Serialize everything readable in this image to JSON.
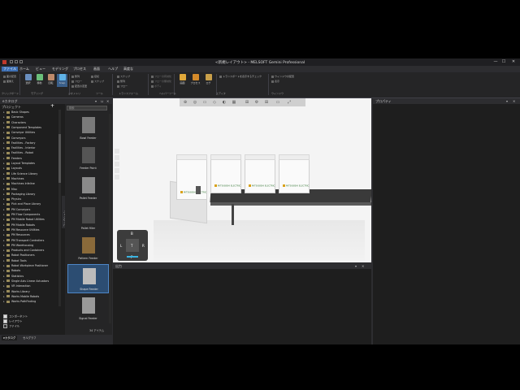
{
  "window": {
    "title": "<新規レイアウト> - MELSOFT Gemini Professional",
    "controls": {
      "minimize": "—",
      "maximize": "☐",
      "close": "✕"
    }
  },
  "menu": [
    "ファイル",
    "ホーム",
    "ビュー",
    "モデリング",
    "プロセス",
    "画面",
    "ヘルプ",
    "高度な"
  ],
  "menu_active_index": 0,
  "ribbon": {
    "buttons": [
      {
        "label": "選択",
        "icon": "select-icon"
      },
      {
        "label": "移動",
        "icon": "move-icon"
      },
      {
        "label": "回転",
        "icon": "rotate-icon"
      },
      {
        "label": "Snap",
        "icon": "snap-icon"
      }
    ],
    "small_items": [
      "面の配置",
      "面揃え",
      "整列",
      "フロー",
      "配置の変更",
      "接続",
      "スナップ",
      "スナップ"
    ],
    "small_right": [
      "フローの有効化",
      "フローの無効化",
      "ボディ"
    ],
    "center_buttons": [
      {
        "label": "画面",
        "icon": "screen-icon"
      },
      {
        "label": "プロセス",
        "icon": "process-icon"
      },
      {
        "label": "ログ",
        "icon": "log-icon"
      }
    ],
    "options": [
      "トランスポートを表示するチェック",
      "ウィンドウの配置",
      "表示"
    ],
    "groups": [
      "クリップボード",
      "モデリング",
      "ジオメトリ",
      "ツール",
      "トランスフォーム",
      "ヘルパーツール",
      "エディタ",
      "ウィンドウ"
    ]
  },
  "catalog": {
    "title": "eカタログ",
    "tree_title": "プロジェクト",
    "tree_items": [
      "Basic Shapes",
      "Cameras",
      "Characters",
      "Component Templates",
      "Conveyor Utilities",
      "Conveyors",
      "Facilities - Factory",
      "Facilities - Interior",
      "Facilities - Robot",
      "Feeders",
      "Layout Templates",
      "Layouts",
      "Life Science Library",
      "Machines",
      "Machines Infeline",
      "Misc",
      "Packaging Library",
      "Physics",
      "Pick and Place Library",
      "PM Conveyors",
      "PM Flow Components",
      "PM Mobile Robot Utilities",
      "PM Mobile Robots",
      "PM Resource Utilities",
      "PM Resources",
      "PM Transport Controllers",
      "PM Warehousing",
      "Products and Containers",
      "Robot Positioners",
      "Robot Tools",
      "Robot Workpiece Positioner",
      "Robots",
      "Statistics",
      "Single Axis Linear Actuators",
      "VR Interaction",
      "Works Library",
      "Works Mobile Robots",
      "Works PathFinding"
    ],
    "vertical_tab": "コレクション",
    "filters": [
      {
        "label": "コンポーネント",
        "checked": true
      },
      {
        "label": "レイアウト",
        "checked": true
      },
      {
        "label": "ファイル",
        "checked": false
      }
    ],
    "search_placeholder": "検索",
    "items": [
      {
        "name": "Bowl Feeder"
      },
      {
        "name": "Feeder Point"
      },
      {
        "name": "Pallet Feeder"
      },
      {
        "name": "Pallet filler"
      },
      {
        "name": "Pattern Feeder"
      },
      {
        "name": "Shape Feeder"
      },
      {
        "name": "Signal Feeder"
      }
    ],
    "selected_item_index": 5,
    "items_count": "34 アイテム",
    "bottom_tabs": [
      "eカタログ",
      "セルグラフ"
    ]
  },
  "viewport": {
    "box_logo": "MITSUBISHI ELECTRIC"
  },
  "nav_cube": {
    "top": "B",
    "left": "L",
    "right": "R",
    "bottom": "F",
    "center": "T"
  },
  "output": {
    "title": "出力"
  },
  "properties": {
    "title": "プロパティ"
  },
  "colors": {
    "accent": "#3c6fb4",
    "selection": "#2c4d72",
    "background": "#2d2d30"
  }
}
